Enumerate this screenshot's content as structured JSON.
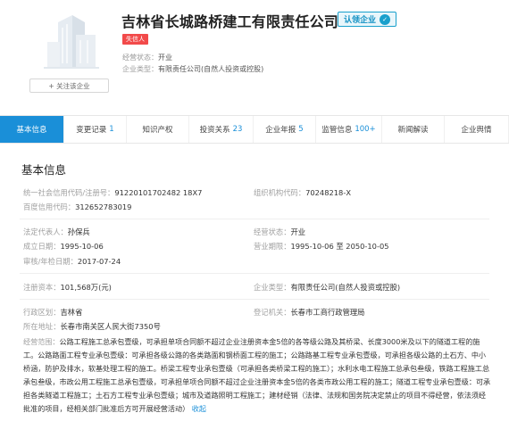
{
  "header": {
    "company_name": "吉林省长城路桥建工有限责任公司",
    "certified_label": "认领企业",
    "certified_mark": "✓",
    "dishonest_tag": "失信人",
    "follow_label": "+ 关注该企业",
    "status_key": "经营状态：",
    "status_value": "开业",
    "type_key": "企业类型：",
    "type_value": "有限责任公司(自然人投资或控股)"
  },
  "tabs": [
    {
      "label": "基本信息",
      "count": ""
    },
    {
      "label": "变更记录",
      "count": "1"
    },
    {
      "label": "知识产权",
      "count": ""
    },
    {
      "label": "投资关系",
      "count": "23"
    },
    {
      "label": "企业年报",
      "count": "5"
    },
    {
      "label": "监管信息",
      "count": "100+"
    },
    {
      "label": "新闻解读",
      "count": ""
    },
    {
      "label": "企业舆情",
      "count": ""
    }
  ],
  "info": {
    "title": "基本信息",
    "credit_code_key": "统一社会信用代码/注册号：",
    "credit_code_value": "91220101702482 18X7",
    "org_code_key": "组织机构代码：",
    "org_code_value": "70248218-X",
    "baidu_code_key": "百度信用代码：",
    "baidu_code_value": "312652783019",
    "legal_rep_key": "法定代表人：",
    "legal_rep_value": "孙保兵",
    "op_status_key": "经营状态：",
    "op_status_value": "开业",
    "founded_key": "成立日期：",
    "founded_value": "1995-10-06",
    "term_key": "营业期限：",
    "term_value": "1995-10-06 至 2050-10-05",
    "approved_key": "审核/年检日期：",
    "approved_value": "2017-07-24",
    "capital_key": "注册资本：",
    "capital_value": "101,568万(元)",
    "ent_type_key": "企业类型：",
    "ent_type_value": "有限责任公司(自然人投资或控股)",
    "region_key": "行政区划：",
    "region_value": "吉林省",
    "authority_key": "登记机关：",
    "authority_value": "长春市工商行政管理局",
    "address_key": "所在地址：",
    "address_value": "长春市南关区人民大街7350号",
    "scope_key": "经营范围：",
    "scope_value": "公路工程施工总承包壹级，可承担单项合同额不超过企业注册资本金5倍的各等级公路及其桥梁、长度3000米及以下的隧道工程的施工。公路路面工程专业承包壹级：可承担各级公路的各类路面和钢桥面工程的施工；公路路基工程专业承包壹级，可承担各级公路的土石方、中小桥涵，防护及排水，软基处理工程的施工。桥梁工程专业承包壹级（可承担各类桥梁工程的施工）；水利水电工程施工总承包叁级，铁路工程施工总承包叁级，市政公用工程施工总承包壹级，可承担单项合同额不超过企业注册资本金5倍的各类市政公用工程的施工；隧道工程专业承包壹级：可承担各类隧道工程施工；土石方工程专业承包壹级；城市及道路照明工程施工；建材经销（法律、法规和国务院决定禁止的项目不得经营，依法须经批准的项目，经相关部门批准后方可开展经营活动）",
    "collapse_label": "收起"
  }
}
